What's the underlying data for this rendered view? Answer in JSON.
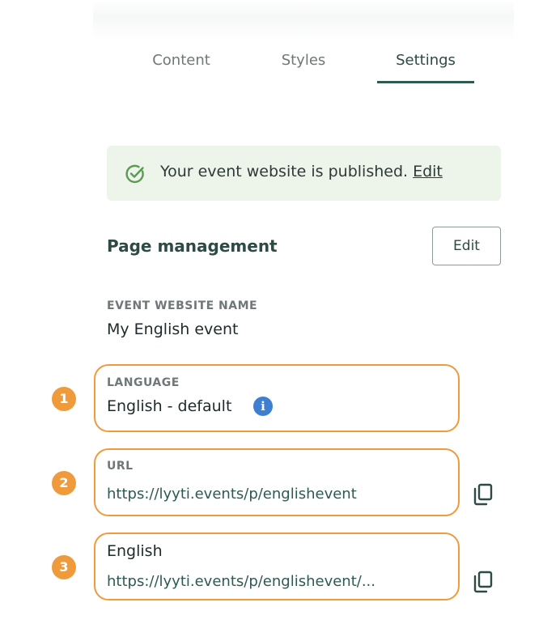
{
  "tabs": {
    "content": "Content",
    "styles": "Styles",
    "settings": "Settings",
    "active": "Settings"
  },
  "banner": {
    "icon": "check-circle-icon",
    "message": "Your event website is published.",
    "link": "Edit"
  },
  "page_management": {
    "title": "Page management",
    "edit_button": "Edit",
    "website_name_label": "EVENT WEBSITE NAME",
    "website_name_value": "My English event",
    "language_label": "LANGUAGE",
    "language_value": "English - default",
    "url_label": "URL",
    "url_value": "https://lyyti.events/p/englishevent",
    "english_label": "English",
    "english_url": "https://lyyti.events/p/englishevent/..."
  },
  "callouts": [
    "1",
    "2",
    "3"
  ],
  "colors": {
    "accent": "#2d4a44",
    "banner_bg": "#edf5ea",
    "highlight": "#ef9b3c",
    "info": "#3f7fd1"
  }
}
